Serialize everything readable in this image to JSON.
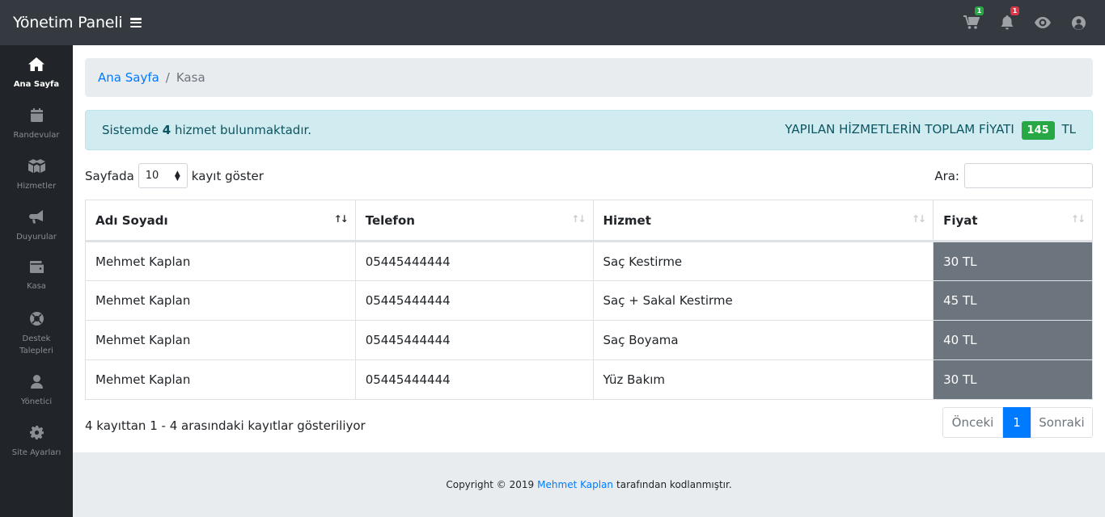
{
  "brand": "Yönetim Paneli",
  "top_badges": {
    "cart": "1",
    "bell": "1"
  },
  "sidebar": [
    {
      "label": "Ana Sayfa",
      "icon": "home-icon"
    },
    {
      "label": "Randevular",
      "icon": "calendar-icon"
    },
    {
      "label": "Hizmetler",
      "icon": "boxes-icon"
    },
    {
      "label": "Duyurular",
      "icon": "bullhorn-icon"
    },
    {
      "label": "Kasa",
      "icon": "wallet-icon"
    },
    {
      "label": "Destek",
      "label2": "Talepleri",
      "icon": "lifering-icon"
    },
    {
      "label": "Yönetici",
      "icon": "user-icon"
    },
    {
      "label": "Site Ayarları",
      "icon": "cog-icon"
    }
  ],
  "breadcrumb": {
    "home": "Ana Sayfa",
    "sep": "/",
    "current": "Kasa"
  },
  "alert": {
    "prefix": "Sistemde",
    "count": "4",
    "suffix": "hizmet bulunmaktadır.",
    "total_label": "YAPILAN HİZMETLERİN TOPLAM FİYATI",
    "total_value": "145",
    "total_unit": "TL"
  },
  "length": {
    "prefix": "Sayfada",
    "value": "10",
    "suffix": "kayıt göster"
  },
  "search": {
    "label": "Ara:",
    "value": ""
  },
  "table": {
    "headers": [
      "Adı Soyadı",
      "Telefon",
      "Hizmet",
      "Fiyat"
    ],
    "rows": [
      [
        "Mehmet Kaplan",
        "05445444444",
        "Saç Kestirme",
        "30 TL"
      ],
      [
        "Mehmet Kaplan",
        "05445444444",
        "Saç + Sakal Kestirme",
        "45 TL"
      ],
      [
        "Mehmet Kaplan",
        "05445444444",
        "Saç Boyama",
        "40 TL"
      ],
      [
        "Mehmet Kaplan",
        "05445444444",
        "Yüz Bakım",
        "30 TL"
      ]
    ]
  },
  "info": "4 kayıttan 1 - 4 arasındaki kayıtlar gösteriliyor",
  "pagination": {
    "prev": "Önceki",
    "page": "1",
    "next": "Sonraki"
  },
  "footer": {
    "prefix": "Copyright © 2019",
    "author": "Mehmet Kaplan",
    "suffix": "tarafından kodlanmıştır."
  },
  "colors": {
    "topbar": "#343a40",
    "sidebar": "#212529",
    "accent": "#007bff",
    "success": "#28a745",
    "price_cell": "#6c757d"
  }
}
